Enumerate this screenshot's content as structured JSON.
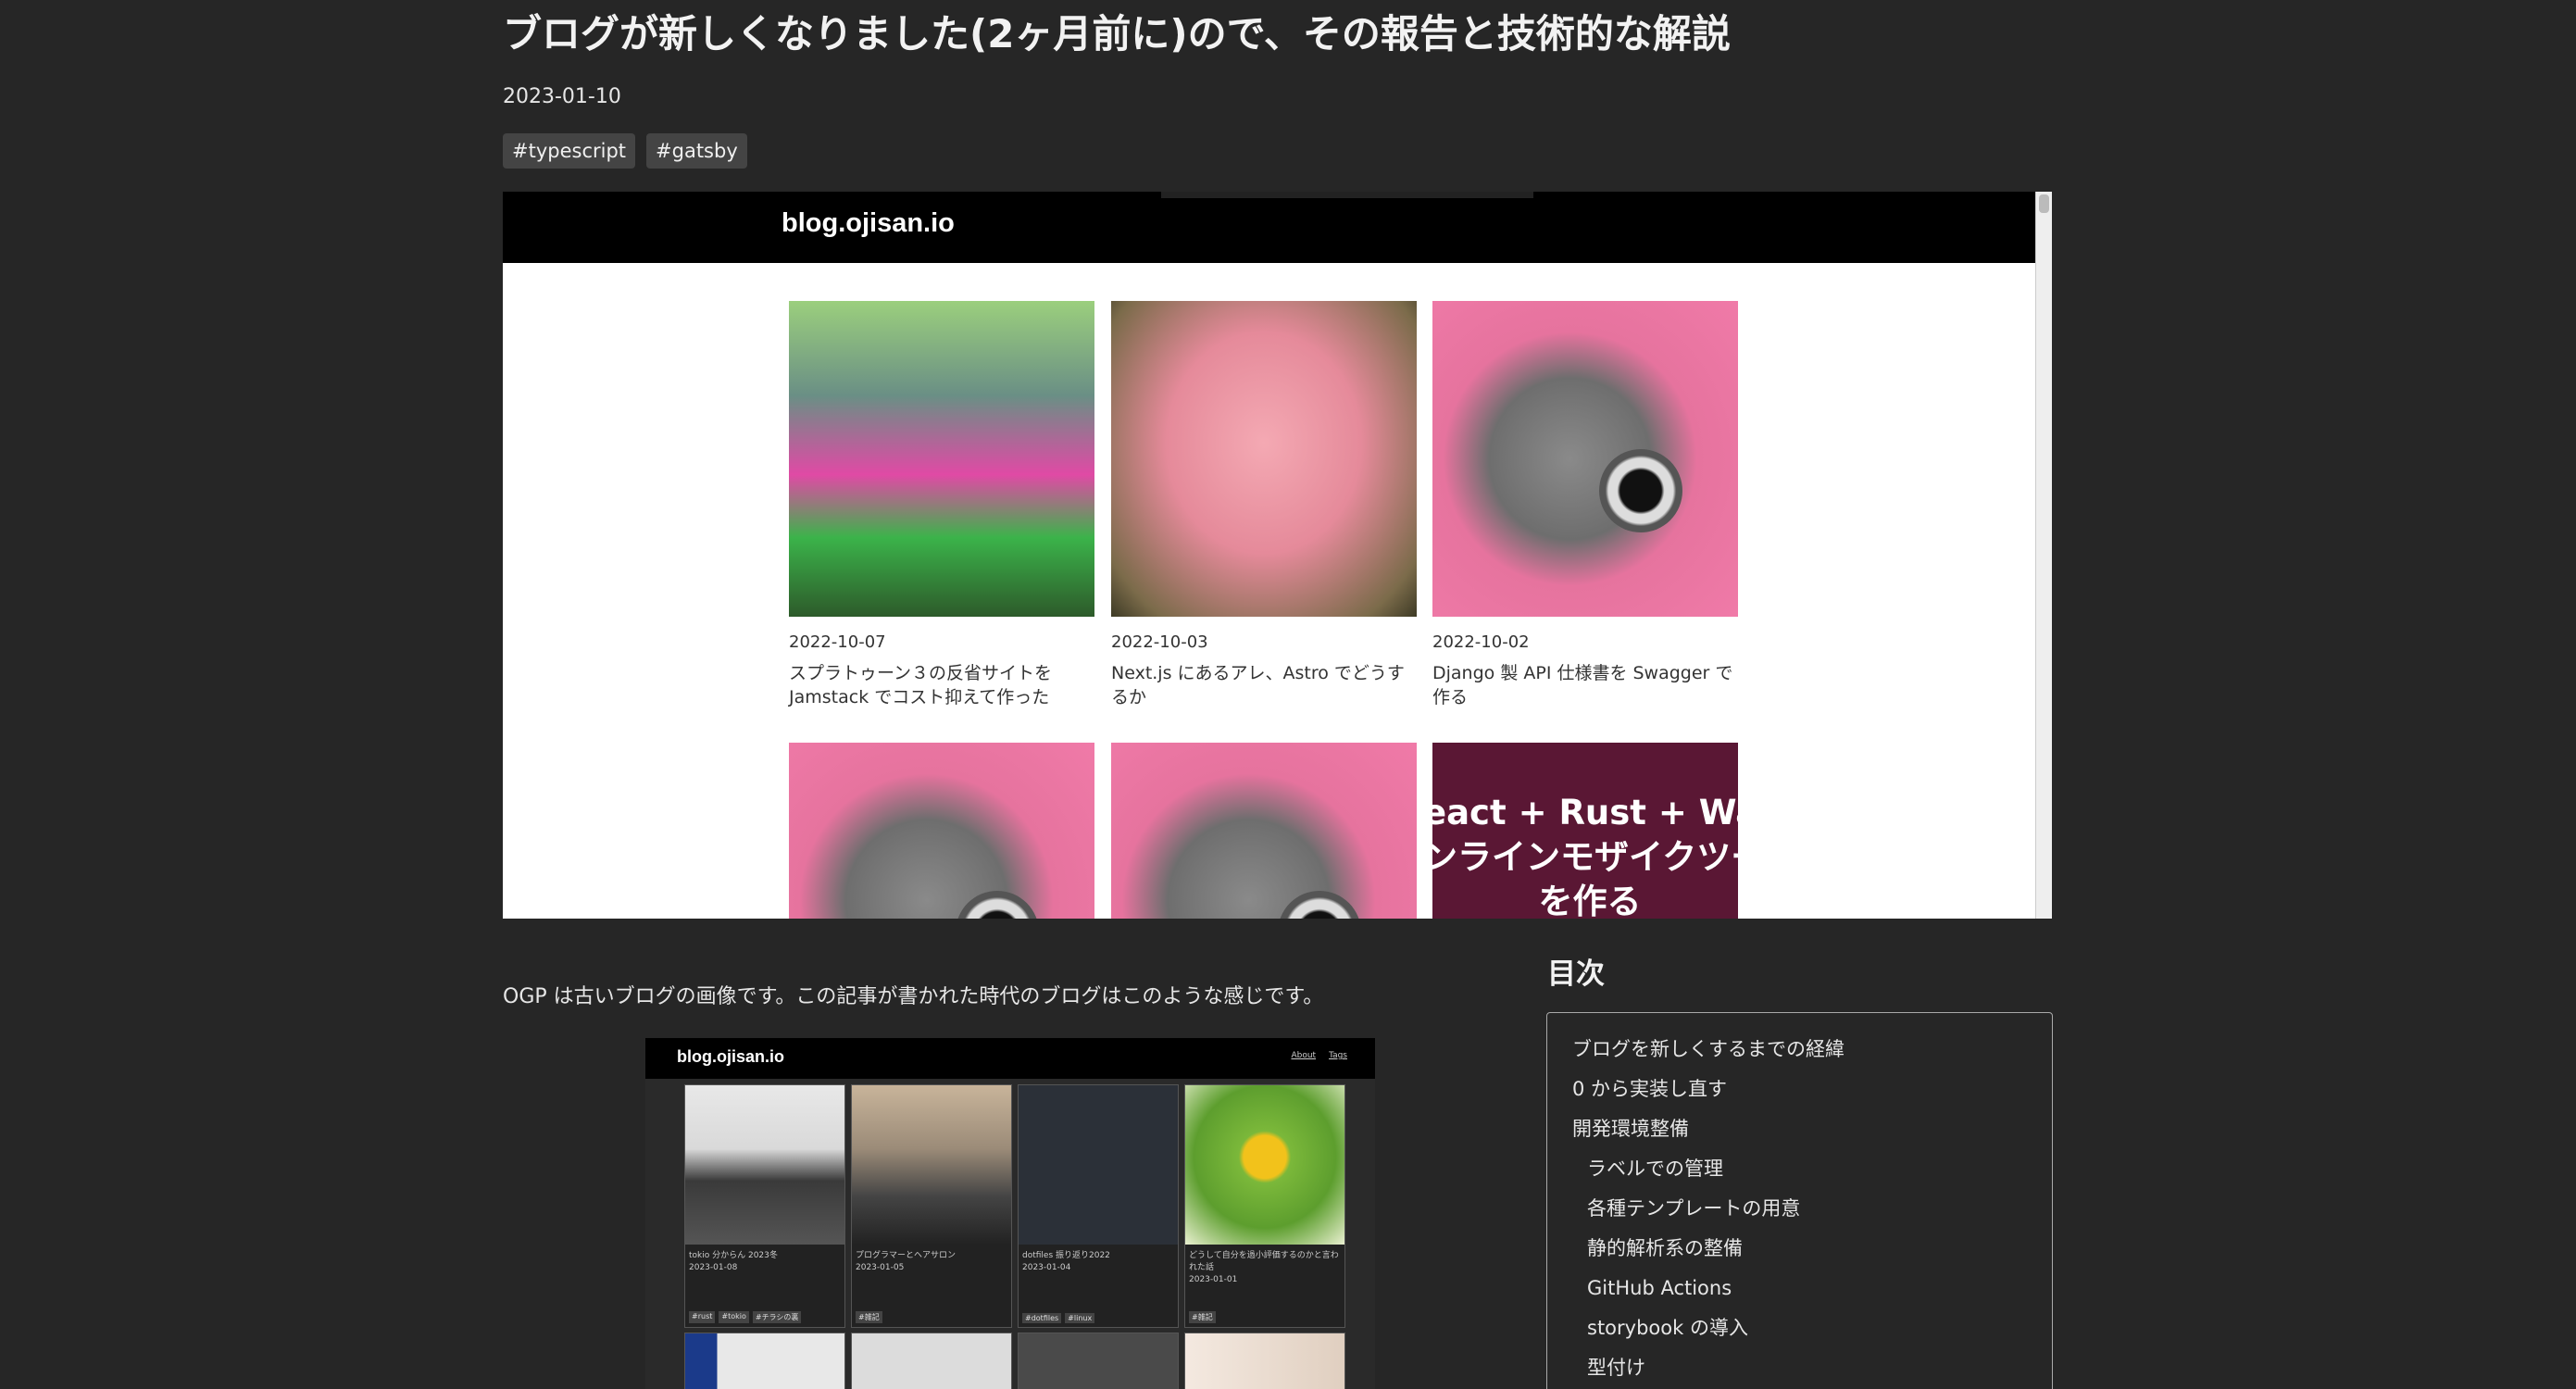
{
  "article": {
    "title": "ブログが新しくなりました(2ヶ月前に)ので、その報告と技術的な解説",
    "date": "2023-01-10",
    "tags": [
      "#typescript",
      "#gatsby"
    ]
  },
  "hero": {
    "logo": "blog.ojisan.io",
    "cards": [
      {
        "date": "2022-10-07",
        "title": "スプラトゥーン３の反省サイトを Jamstack でコスト抑えて作った"
      },
      {
        "date": "2022-10-03",
        "title": "Next.js にあるアレ、Astro でどうするか"
      },
      {
        "date": "2022-10-02",
        "title": "Django 製 API 仕様書を Swagger で作る"
      }
    ],
    "wasm_text": "eact + Rust + Wasm\nンラインモザイクツー\nを作る"
  },
  "intro_text": "OGP は古いブログの画像です。この記事が書かれた時代のブログはこのような感じです。",
  "screenshot": {
    "logo": "blog.ojisan.io",
    "links": [
      "About",
      "Tags"
    ],
    "cards": [
      {
        "title": "tokio 分からん 2023冬",
        "date": "2023-01-08",
        "tags": [
          "#rust",
          "#tokio",
          "#チラシの裏"
        ]
      },
      {
        "title": "プログラマーとヘアサロン",
        "date": "2023-01-05",
        "tags": [
          "#雑記"
        ]
      },
      {
        "title": "dotfiles 振り返り2022",
        "date": "2023-01-04",
        "tags": [
          "#dotfiles",
          "#linux"
        ]
      },
      {
        "title": "どうして自分を過小評価するのかと言われた話",
        "date": "2023-01-01",
        "tags": [
          "#雑記"
        ]
      }
    ]
  },
  "toc": {
    "heading": "目次",
    "items": [
      {
        "label": "ブログを新しくするまでの経緯",
        "level": 1
      },
      {
        "label": "0 から実装し直す",
        "level": 1
      },
      {
        "label": "開発環境整備",
        "level": 1
      },
      {
        "label": "ラベルでの管理",
        "level": 2
      },
      {
        "label": "各種テンプレートの用意",
        "level": 2
      },
      {
        "label": "静的解析系の整備",
        "level": 2
      },
      {
        "label": "GitHub Actions",
        "level": 2
      },
      {
        "label": "storybook の導入",
        "level": 2
      },
      {
        "label": "型付け",
        "level": 2
      }
    ]
  }
}
